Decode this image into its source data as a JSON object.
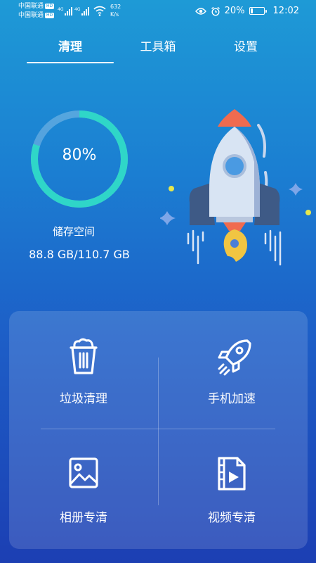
{
  "status_bar": {
    "carrier1": "中国联通",
    "carrier2": "中国联通",
    "hd_badge": "HD",
    "network1": "4G",
    "network2": "4G",
    "speed_value": "632",
    "speed_unit": "K/s",
    "battery_percent": "20%",
    "battery_level": 0.2,
    "time": "12:02",
    "icons": [
      "eye-icon",
      "alarm-icon",
      "battery-charging-icon"
    ]
  },
  "tabs": [
    {
      "label": "清理",
      "active": true
    },
    {
      "label": "工具箱",
      "active": false
    },
    {
      "label": "设置",
      "active": false
    }
  ],
  "storage": {
    "percent_text": "80%",
    "percent": 80,
    "label": "储存空间",
    "value": "88.8 GB/110.7 GB",
    "ring_color": "#2fd6c8"
  },
  "actions": [
    {
      "label": "垃圾清理",
      "icon": "trash-icon"
    },
    {
      "label": "手机加速",
      "icon": "rocket-icon"
    },
    {
      "label": "相册专清",
      "icon": "image-icon"
    },
    {
      "label": "视频专清",
      "icon": "video-file-icon"
    }
  ]
}
